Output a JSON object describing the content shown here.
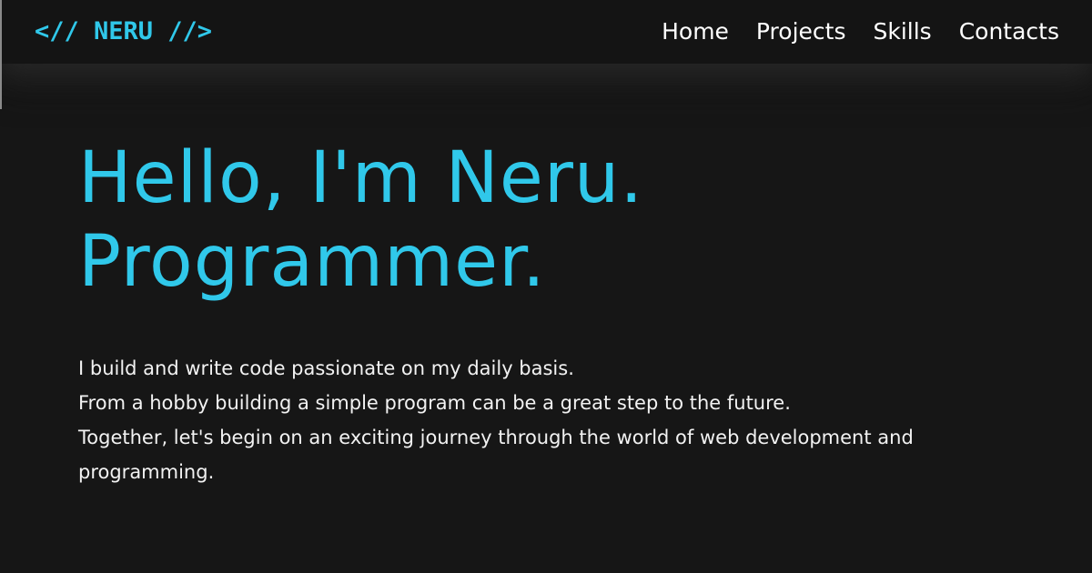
{
  "nav": {
    "logo": "<// NERU //>",
    "links": [
      "Home",
      "Projects",
      "Skills",
      "Contacts"
    ]
  },
  "hero": {
    "title_line1": "Hello, I'm Neru.",
    "title_line2": "Programmer.",
    "paragraphs": [
      "I build and write code passionate on my daily basis.",
      "From a hobby building a simple program can be a great step to the future.",
      "Together, let's begin on an exciting journey through the world of web development and programming."
    ]
  },
  "colors": {
    "accent": "#30c8ea",
    "background": "#161616",
    "navbar": "#141414",
    "text": "#f2f2f2"
  }
}
